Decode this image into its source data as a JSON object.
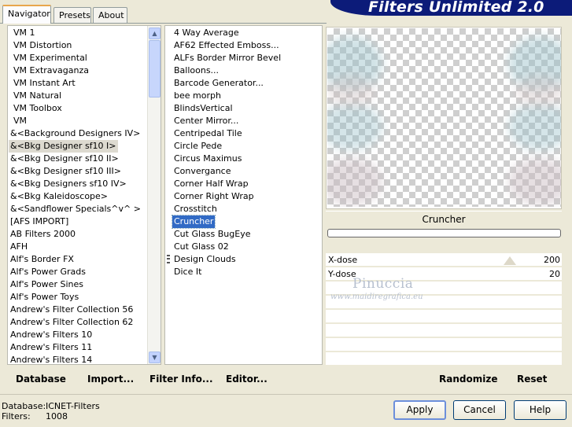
{
  "tabs": [
    {
      "label": "Navigator",
      "active": true
    },
    {
      "label": "Presets",
      "active": false
    },
    {
      "label": "About",
      "active": false
    }
  ],
  "banner_title": "Filters Unlimited 2.0",
  "categories": [
    "VM 1",
    "VM Distortion",
    "VM Experimental",
    "VM Extravaganza",
    "VM Instant Art",
    "VM Natural",
    "VM Toolbox",
    "VM",
    "&<Background Designers IV>",
    "&<Bkg Designer sf10 I>",
    "&<Bkg Designer sf10 II>",
    "&<Bkg Designer sf10 III>",
    "&<Bkg Designers sf10 IV>",
    "&<Bkg Kaleidoscope>",
    "&<Sandflower Specials^v^ >",
    "[AFS IMPORT]",
    "AB Filters 2000",
    "AFH",
    "Alf's Border FX",
    "Alf's Power Grads",
    "Alf's Power Sines",
    "Alf's Power Toys",
    "Andrew's Filter Collection 56",
    "Andrew's Filter Collection 62",
    "Andrew's Filters 10",
    "Andrew's Filters 11",
    "Andrew's Filters 14"
  ],
  "selected_category": "&<Bkg Designer sf10 I>",
  "filters": [
    "4 Way Average",
    "AF62 Effected Emboss...",
    "ALFs Border Mirror Bevel",
    "Balloons...",
    "Barcode Generator...",
    "bee morph",
    "BlindsVertical",
    "Center Mirror...",
    "Centripedal Tile",
    "Circle Pede",
    "Circus Maximus",
    "Convergance",
    "Corner Half Wrap",
    "Corner Right Wrap",
    "Crosstitch",
    "Cruncher",
    "Cut Glass  BugEye",
    "Cut Glass 02",
    "Design Clouds",
    "Dice It"
  ],
  "selected_filter": "Cruncher",
  "left_buttons": {
    "database": "Database",
    "import": "Import...",
    "filter_info": "Filter Info...",
    "editor": "Editor..."
  },
  "preview": {
    "filter_name": "Cruncher"
  },
  "params": [
    {
      "label": "X-dose",
      "value": "200",
      "fraction": 0.78
    },
    {
      "label": "Y-dose",
      "value": "20",
      "fraction": 0.08
    }
  ],
  "watermark": {
    "name": "Pinuccia",
    "url": "www.maidiregrafica.eu"
  },
  "right_buttons": {
    "randomize": "Randomize",
    "reset": "Reset"
  },
  "info": {
    "database_label": "Database:",
    "database_value": "ICNET-Filters",
    "filters_label": "Filters:",
    "filters_value": "1008"
  },
  "dialog_buttons": {
    "apply": "Apply",
    "cancel": "Cancel",
    "help": "Help"
  },
  "colors": {
    "banner": "#0c1b79",
    "selection": "#316ac5",
    "dialog_bg": "#ece9d8"
  }
}
